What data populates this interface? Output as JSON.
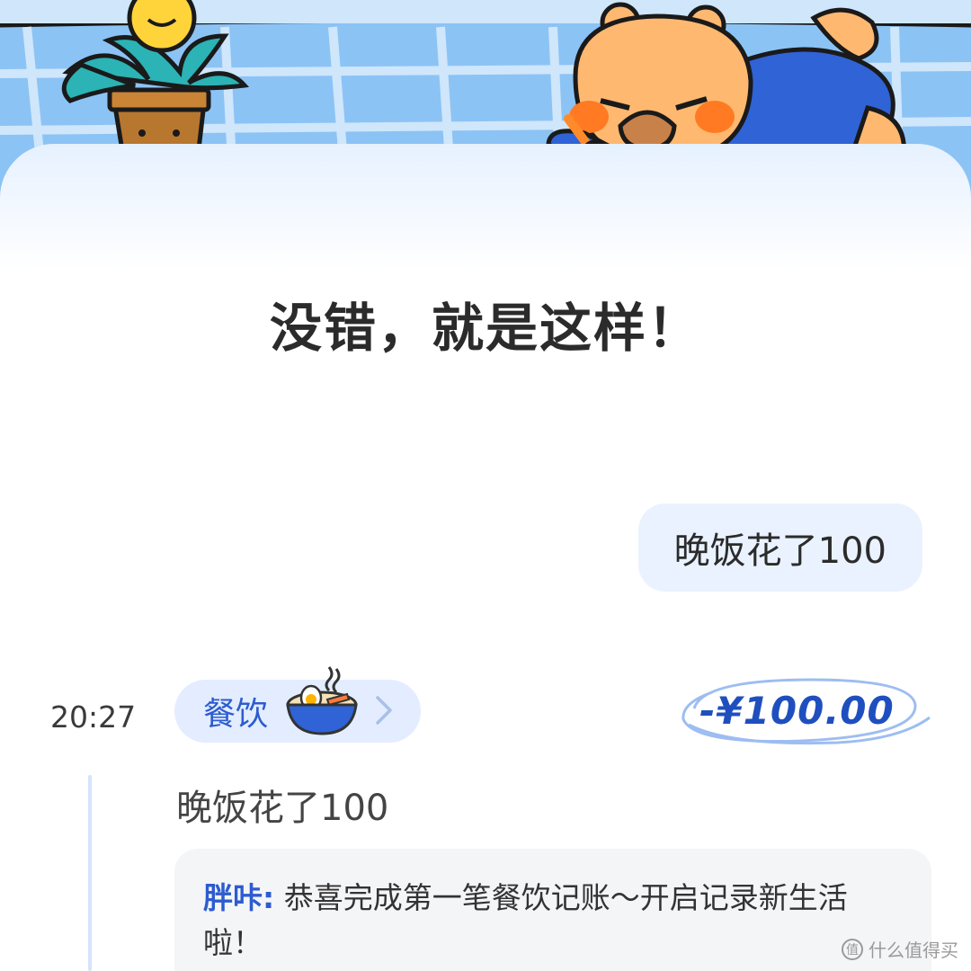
{
  "header": {
    "headline": "没错，就是这样！"
  },
  "chat": {
    "user_message": "晚饭花了100"
  },
  "entry": {
    "time": "20:27",
    "category": "餐饮",
    "category_icon": "noodle-bowl-icon",
    "amount": "-¥100.00",
    "note": "晚饭花了100",
    "reply": {
      "speaker": "胖咔:",
      "text": " 恭喜完成第一笔餐饮记账～开启记录新生活啦！"
    }
  },
  "watermark": {
    "logo": "值",
    "text": "什么值得买"
  },
  "colors": {
    "accent_blue": "#2d5ccf",
    "amount_blue": "#1f4fbf",
    "bubble_bg": "#eaf2ff",
    "hero_sky": "#8cc3f5"
  }
}
